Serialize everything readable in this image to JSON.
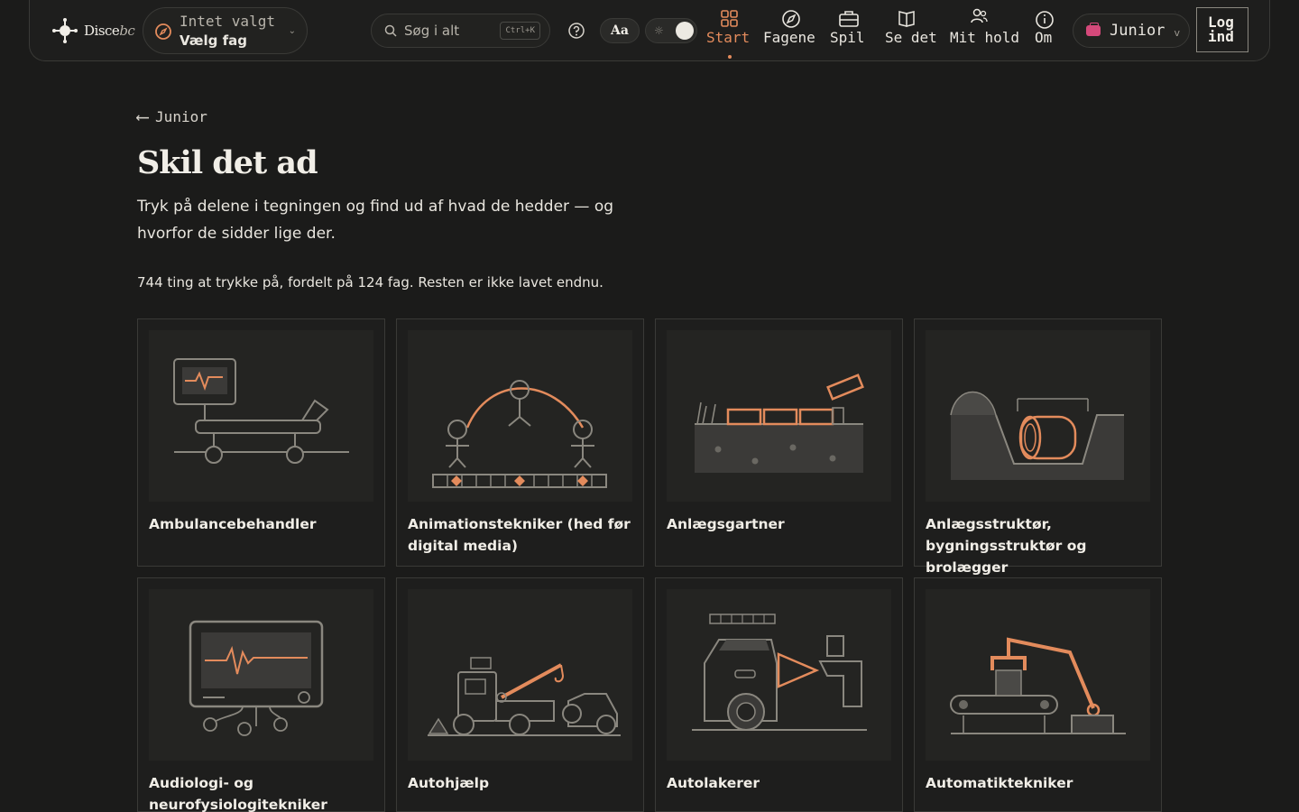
{
  "header": {
    "logo_main": "Disce",
    "logo_accent": "bc",
    "subject_status": "Intet valgt",
    "subject_action": "Vælg fag",
    "search_placeholder": "Søg i alt",
    "search_shortcut": "Ctrl+K",
    "font_button": "Aa",
    "nav": [
      {
        "label": "Start",
        "icon": "grid-icon",
        "active": true
      },
      {
        "label": "Fagene",
        "icon": "compass-icon"
      },
      {
        "label": "Spil",
        "icon": "briefcase-icon"
      },
      {
        "label": "Se det",
        "icon": "book-icon"
      },
      {
        "label": "Mit hold",
        "icon": "users-icon"
      },
      {
        "label": "Om",
        "icon": "info-icon"
      }
    ],
    "audience": "Junior",
    "login": "Log ind"
  },
  "page": {
    "back_label": "Junior",
    "title": "Skil det ad",
    "lead": "Tryk på delene i tegningen og find ud af hvad de hedder — og hvorfor de sidder lige der.",
    "count_text": "744 ting at trykke på, fordelt på 124 fag. Resten er ikke lavet endnu."
  },
  "cards": [
    {
      "name": "Ambulancebehandler"
    },
    {
      "name": "Animationstekniker (hed før digital media)"
    },
    {
      "name": "Anlægsgartner"
    },
    {
      "name": "Anlægsstruktør, bygningsstruktør og brolægger"
    },
    {
      "name": "Audiologi- og neurofysiologitekniker"
    },
    {
      "name": "Autohjælp"
    },
    {
      "name": "Autolakerer"
    },
    {
      "name": "Automatiktekniker"
    }
  ],
  "colors": {
    "accent": "#e38b5c",
    "background": "#1b1b1a",
    "line": "#8a877f"
  }
}
